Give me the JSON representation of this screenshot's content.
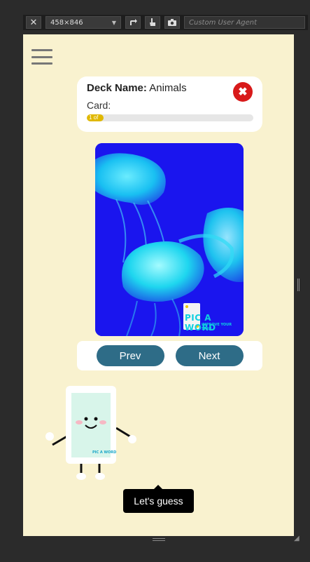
{
  "toolbar": {
    "close_glyph": "✕",
    "device_size": "458×846",
    "user_agent_placeholder": "Custom User Agent",
    "icons": [
      "close-icon",
      "chevron-down-icon",
      "rotate-icon",
      "touch-icon",
      "camera-icon"
    ]
  },
  "deck": {
    "name_label": "Deck Name:",
    "name_value": "Animals",
    "card_label": "Card:",
    "progress_text": "1 of",
    "progress_fraction": 0.1,
    "close_glyph": "✖"
  },
  "image": {
    "watermark_line1": "PIC A WORD",
    "watermark_line2": "IMPROVE YOUR SKILL"
  },
  "navigation": {
    "prev_label": "Prev",
    "next_label": "Next"
  },
  "mascot": {
    "logo_text": "PIC A WORD"
  },
  "tooltip": {
    "text": "Let's guess"
  },
  "colors": {
    "page_background": "#f9f2cf",
    "button": "#2e6c87",
    "close_button": "#d81a1a",
    "progress": "#e0b800",
    "image_background": "#1a15ee"
  }
}
